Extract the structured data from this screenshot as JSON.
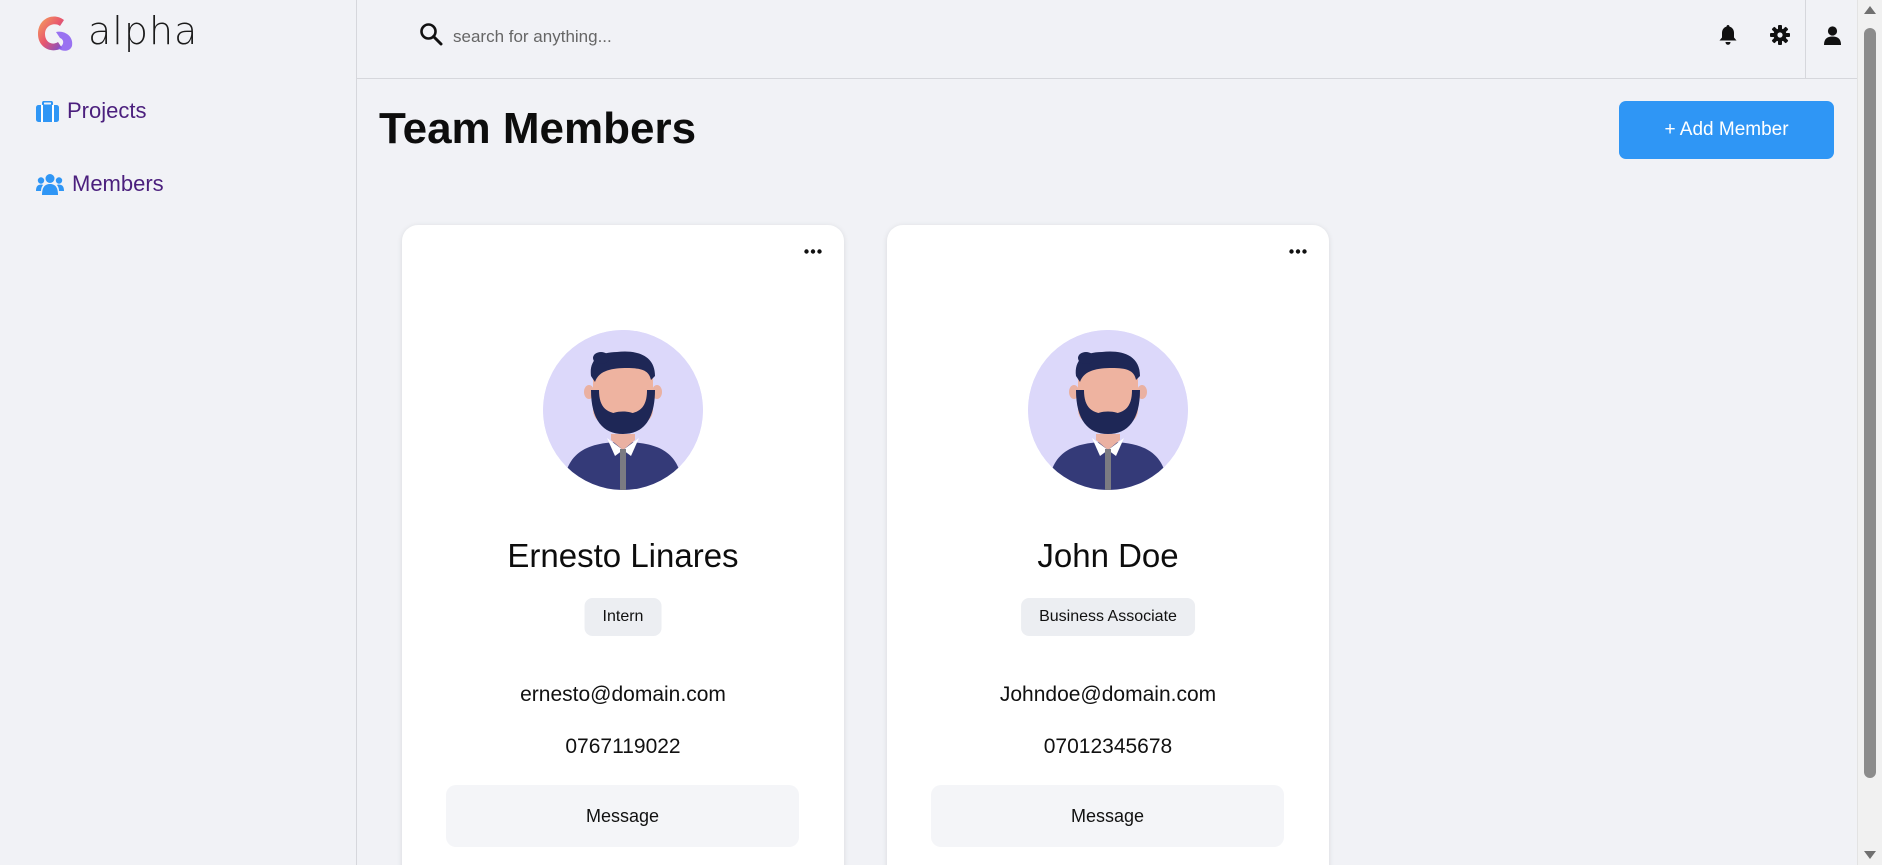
{
  "app": {
    "logo_text": "alpha"
  },
  "sidebar": {
    "items": [
      {
        "label": "Projects",
        "icon": "briefcase-icon"
      },
      {
        "label": "Members",
        "icon": "users-icon"
      }
    ]
  },
  "topbar": {
    "search_placeholder": "search for anything...",
    "icons": [
      "bell-icon",
      "gear-icon",
      "user-icon"
    ]
  },
  "main": {
    "title": "Team Members",
    "add_button_label": "+ Add Member",
    "members": [
      {
        "name": "Ernesto Linares",
        "role": "Intern",
        "email": "ernesto@domain.com",
        "phone": "0767119022",
        "message_label": "Message"
      },
      {
        "name": "John Doe",
        "role": "Business Associate",
        "email": "Johndoe@domain.com",
        "phone": "07012345678",
        "message_label": "Message"
      }
    ]
  },
  "colors": {
    "accent": "#2f96f5",
    "nav_text": "#4b1f7d",
    "background": "#f1f2f6",
    "avatar_bg": "#dcd8fa"
  }
}
